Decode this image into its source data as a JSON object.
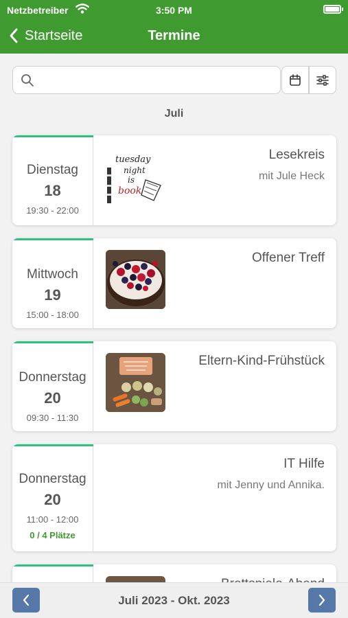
{
  "status_bar": {
    "carrier": "Netzbetreiber",
    "time": "3:50 PM"
  },
  "nav": {
    "back_label": "Startseite",
    "title": "Termine"
  },
  "search": {
    "value": "",
    "placeholder": ""
  },
  "month_label": "Juli",
  "events": [
    {
      "weekday": "Dienstag",
      "day": "18",
      "hours": "19:30 - 22:00",
      "title": "Lesekreis",
      "subtitle": "mit Jule Heck"
    },
    {
      "weekday": "Mittwoch",
      "day": "19",
      "hours": "15:00 - 18:00",
      "title": "Offener Treff"
    },
    {
      "weekday": "Donnerstag",
      "day": "20",
      "hours": "09:30 - 11:30",
      "title": "Eltern-Kind-Frühstück"
    },
    {
      "weekday": "Donnerstag",
      "day": "20",
      "hours": "11:00 - 12:00",
      "places": "0 / 4 Plätze",
      "title": "IT Hilfe",
      "subtitle": "mit Jenny und Annika."
    },
    {
      "title": "Brettspiele-Abend"
    }
  ],
  "thumb_text": {
    "booked_line1": "tuesday",
    "booked_line2": "night",
    "booked_line3": "is",
    "booked_line4": "booked"
  },
  "footer": {
    "range": "Juli 2023 - Okt. 2023"
  },
  "colors": {
    "brand_green": "#3f9a2f",
    "accent_green": "#2ec27e",
    "pager_blue": "#5578a8"
  },
  "icons": {
    "back": "chevron-left-icon",
    "search": "search-icon",
    "calendar": "calendar-icon",
    "filter": "sliders-icon",
    "prev": "chevron-left-icon",
    "next": "chevron-right-icon"
  }
}
